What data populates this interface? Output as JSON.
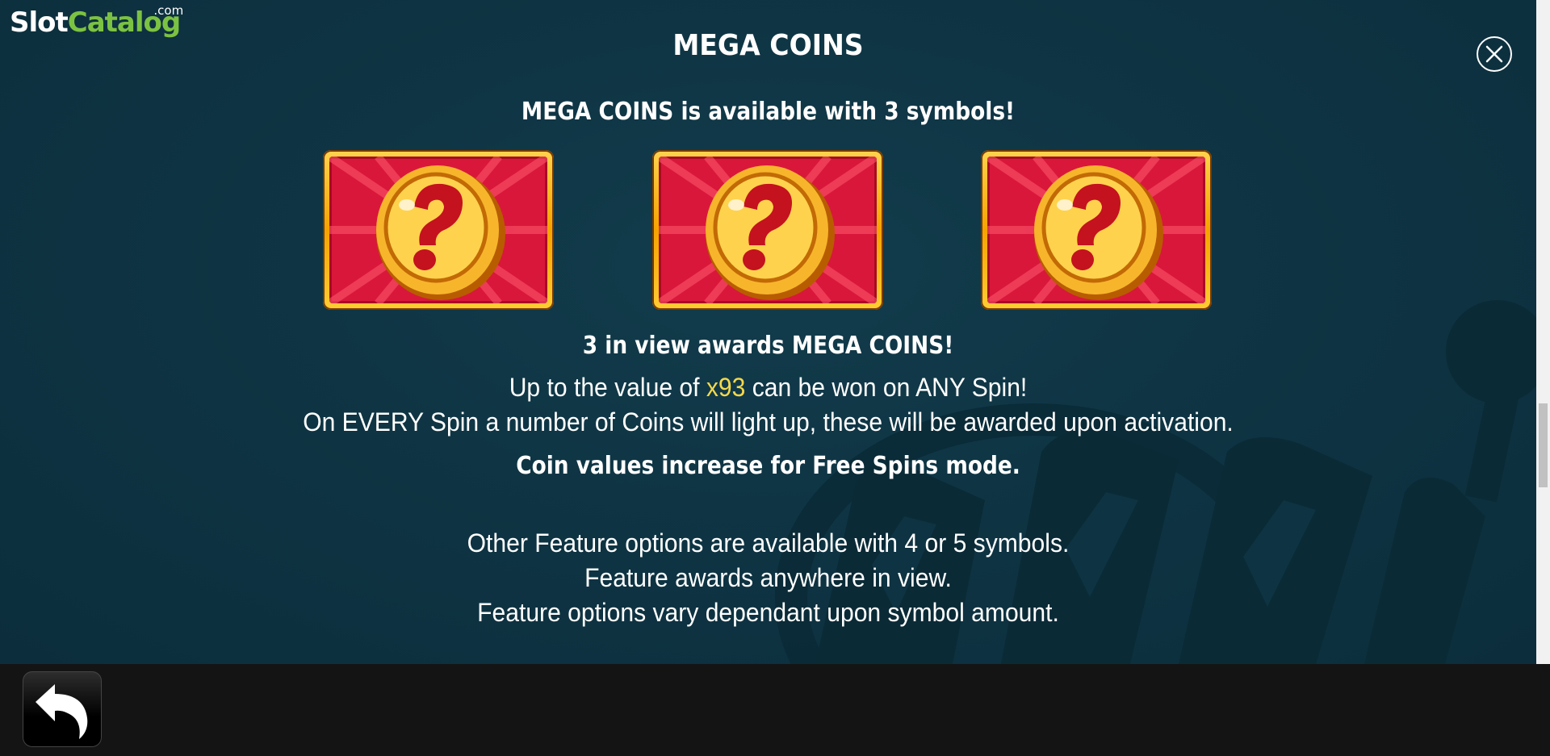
{
  "logo": {
    "slot": "Slot",
    "catalog": "Catalog",
    "com": ".com"
  },
  "title": "MEGA COINS",
  "subtitle": "MEGA COINS is available with 3 symbols!",
  "symbols": [
    {
      "icon": "mega-coin-question-icon"
    },
    {
      "icon": "mega-coin-question-icon"
    },
    {
      "icon": "mega-coin-question-icon"
    }
  ],
  "description": {
    "award_line": "3 in view awards MEGA COINS!",
    "value_prefix": "Up to the value of ",
    "value_highlight": "x93",
    "value_suffix": " can be won on ANY Spin!",
    "every_spin_line": "On EVERY Spin a number of Coins will light up, these will be awarded upon activation.",
    "free_spins_line": "Coin values increase for Free Spins mode.",
    "other_options_line": "Other Feature options are available with 4 or 5 symbols.",
    "anywhere_line": "Feature awards anywhere in view.",
    "vary_line": "Feature options vary dependant upon symbol amount."
  },
  "controls": {
    "close_icon": "close-icon",
    "back_icon": "back-arrow-icon"
  },
  "colors": {
    "background": "#0e3342",
    "highlight": "#f5d84b",
    "bottom_bar": "#141414",
    "logo_green": "#7cc242"
  }
}
